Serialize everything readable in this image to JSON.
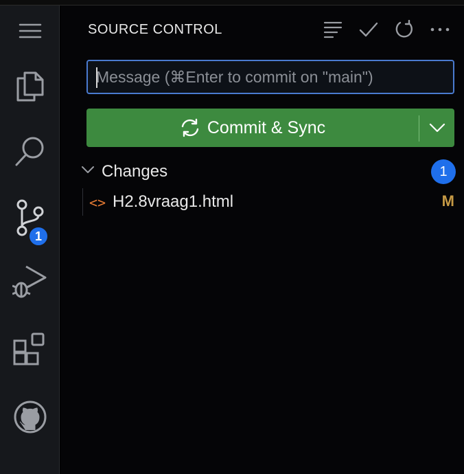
{
  "panel": {
    "title": "SOURCE CONTROL"
  },
  "activity_bar": {
    "items": [
      {
        "name": "menu"
      },
      {
        "name": "explorer"
      },
      {
        "name": "search"
      },
      {
        "name": "source-control",
        "badge": "1"
      },
      {
        "name": "run-and-debug"
      },
      {
        "name": "extensions"
      },
      {
        "name": "github"
      }
    ]
  },
  "commit": {
    "placeholder": "Message (⌘Enter to commit on \"main\")",
    "value": "",
    "button_label": "Commit & Sync"
  },
  "changes": {
    "label": "Changes",
    "count": "1",
    "files": [
      {
        "name": "H2.8vraag1.html",
        "status": "M",
        "icon": "html-code-icon"
      }
    ]
  },
  "colors": {
    "accent": "#1f6feb",
    "commit_button": "#3d8a3f",
    "modified": "#c69a45",
    "html_icon": "#e37933"
  }
}
